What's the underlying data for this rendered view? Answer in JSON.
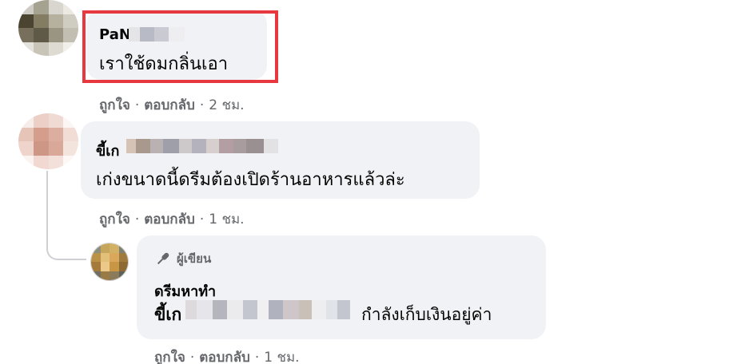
{
  "comments": [
    {
      "author_visible": "PaN",
      "text": "เราใช้ดมกลิ่นเอา",
      "actions": {
        "like": "ถูกใจ",
        "reply": "ตอบกลับ",
        "time": "2 ชม.",
        "separator": "·"
      }
    },
    {
      "author_visible": "ขี้เก",
      "text": "เก่งขนาดนี้ดรีมต้องเปิดร้านอาหารแล้วล่ะ",
      "actions": {
        "like": "ถูกใจ",
        "reply": "ตอบกลับ",
        "time": "1 ชม.",
        "separator": "·"
      }
    }
  ],
  "reply": {
    "badge_label": "ผู้เขียน",
    "badge_icon": "microphone-icon",
    "author": "ดรีมหาทำ",
    "mention_visible": "ขี้เก",
    "text": "กำลังเก็บเงินอยู่ค่า",
    "actions": {
      "like": "ถูกใจ",
      "reply": "ตอบกลับ",
      "time": "1 ชม.",
      "separator": "·"
    }
  },
  "colors": {
    "bubble": "#f0f2f5",
    "highlight": "#e8383f",
    "secondary_text": "#65676b"
  }
}
